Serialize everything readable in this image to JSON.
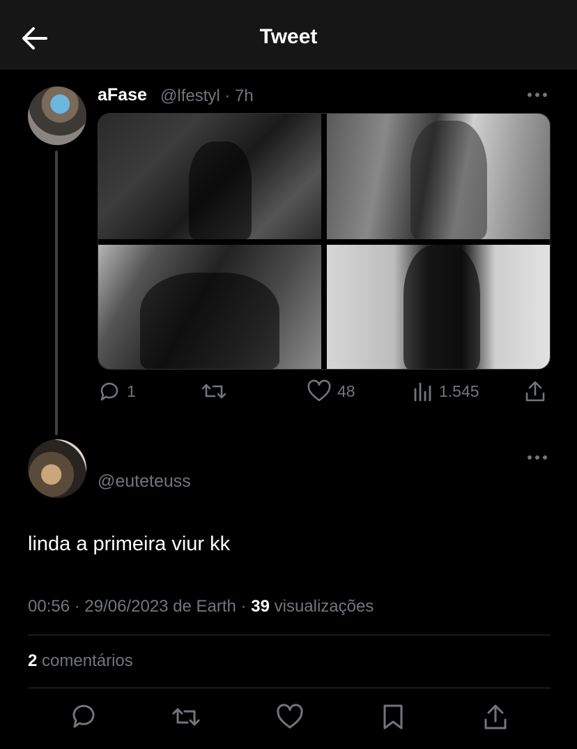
{
  "header": {
    "title": "Tweet",
    "back_icon": "arrow-left-icon"
  },
  "tweet": {
    "display_name": "aFase",
    "handle_time": "@lfestyl · 7h",
    "media_count": 4,
    "stats": {
      "replies": "1",
      "likes": "48",
      "views": "1.545"
    }
  },
  "reply": {
    "handle": "@euteteuss",
    "text": "linda a primeira viur kk",
    "meta_prefix": "00:56 · 29/06/2023 de Earth · ",
    "views_count": "39",
    "views_label": " visualizações",
    "comments_count": "2",
    "comments_label": " comentários"
  },
  "colors": {
    "background": "#000000",
    "topbar": "#161616",
    "muted": "#71767b",
    "text": "#e7e9ea",
    "divider": "#2f3336"
  }
}
